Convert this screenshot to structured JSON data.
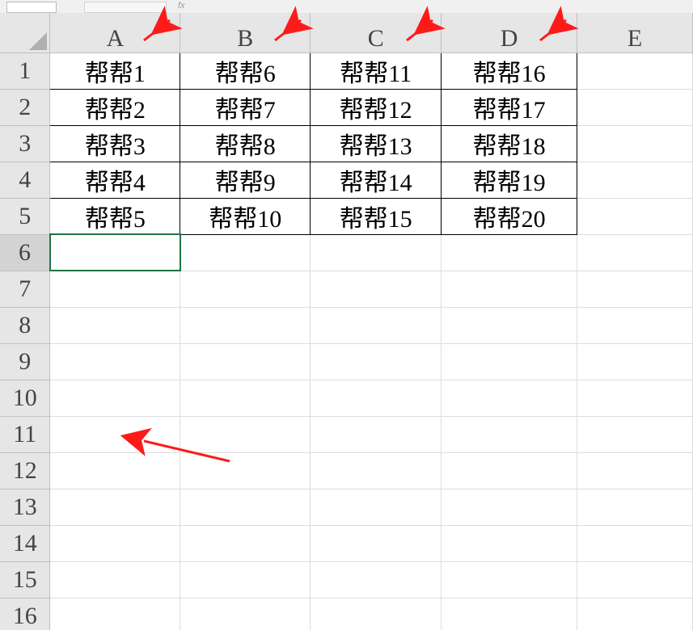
{
  "formula_bar": {
    "fx_label": "fx"
  },
  "columns": [
    "A",
    "B",
    "C",
    "D",
    "E"
  ],
  "rows": [
    "1",
    "2",
    "3",
    "4",
    "5",
    "6",
    "7",
    "8",
    "9",
    "10",
    "11",
    "12",
    "13",
    "14",
    "15",
    "16"
  ],
  "active_cell": "A6",
  "cells": {
    "A1": "帮帮1",
    "A2": "帮帮2",
    "A3": "帮帮3",
    "A4": "帮帮4",
    "A5": "帮帮5",
    "B1": "帮帮6",
    "B2": "帮帮7",
    "B3": "帮帮8",
    "B4": "帮帮9",
    "B5": "帮帮10",
    "C1": "帮帮11",
    "C2": "帮帮12",
    "C3": "帮帮13",
    "C4": "帮帮14",
    "C5": "帮帮15",
    "D1": "帮帮16",
    "D2": "帮帮17",
    "D3": "帮帮18",
    "D4": "帮帮19",
    "D5": "帮帮20"
  }
}
